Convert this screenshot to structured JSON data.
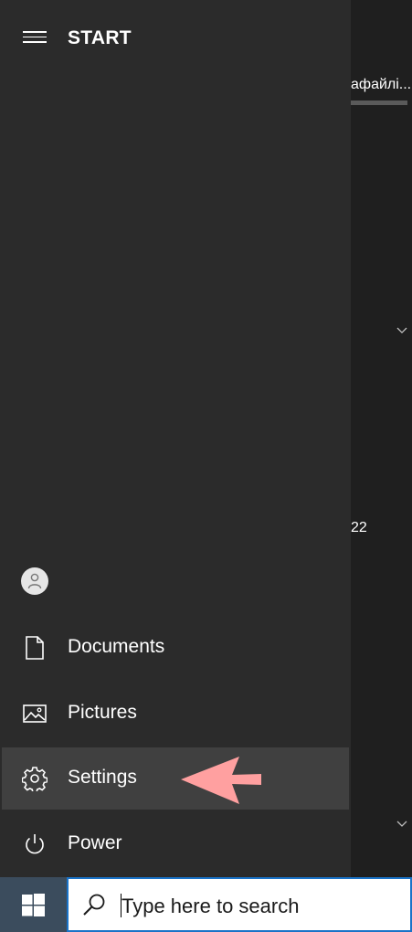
{
  "background": {
    "text1": "афайлі...",
    "text2": "22"
  },
  "start": {
    "title": "START",
    "items": [
      {
        "label": "Documents"
      },
      {
        "label": "Pictures"
      },
      {
        "label": "Settings"
      },
      {
        "label": "Power"
      }
    ],
    "selected": "Settings"
  },
  "taskbar": {
    "search_placeholder": "Type here to search"
  },
  "colors": {
    "panel": "#2b2b2b",
    "selected": "#404040",
    "arrow": "#ffa0a0",
    "taskbar": "#3b4c5d",
    "search_border": "#1a73c8"
  }
}
